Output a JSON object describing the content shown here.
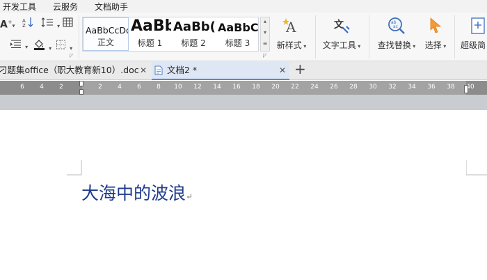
{
  "menubar": {
    "items": [
      "开发工具",
      "云服务",
      "文档助手"
    ]
  },
  "ribbon": {
    "styles": [
      {
        "sample": "AaBbCcDd",
        "name": "正文"
      },
      {
        "sample": "AaBb",
        "name": "标题 1"
      },
      {
        "sample": "AaBb(",
        "name": "标题 2"
      },
      {
        "sample": "AaBbC",
        "name": "标题 3"
      }
    ],
    "new_style_label": "新样式",
    "text_tools_label": "文字工具",
    "find_replace_label": "查找替换",
    "select_label": "选择",
    "super_label": "超级简"
  },
  "tabs": [
    {
      "title": "刁题集office（职大教育新10）.doc",
      "close": "✕"
    },
    {
      "title": "文档2 *",
      "close": "✕"
    }
  ],
  "new_tab_symbol": "+",
  "ruler": {
    "left_numbers": [
      "6",
      "4",
      "2"
    ],
    "right_numbers": [
      "2",
      "4",
      "6",
      "8",
      "10",
      "12",
      "14",
      "16",
      "18",
      "20",
      "22",
      "24",
      "26",
      "28",
      "30",
      "32",
      "34",
      "36",
      "38",
      "40"
    ]
  },
  "document": {
    "text": "大海中的波浪",
    "paragraph_mark": "↵"
  },
  "colors": {
    "accent": "#5b87d6",
    "doc_text": "#1f3b8c"
  }
}
